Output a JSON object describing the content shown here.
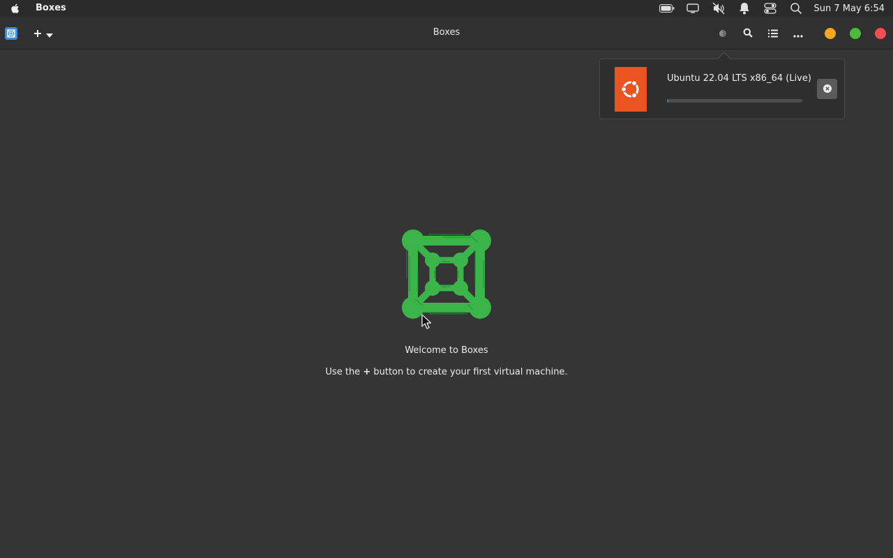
{
  "system_bar": {
    "app_name": "Boxes",
    "clock": "Sun 7 May 6:54",
    "icons": [
      "apple-icon",
      "battery-icon",
      "display-icon",
      "volume-muted-icon",
      "notification-bell-icon",
      "control-center-icon",
      "spotlight-search-icon"
    ]
  },
  "header": {
    "title": "Boxes",
    "icons": [
      "boxes-app-icon",
      "plus-icon",
      "chevron-down-icon",
      "downloads-indicator-icon",
      "search-icon",
      "list-view-icon",
      "more-options-icon"
    ],
    "window_controls": {
      "minimize_color": "#f5a623",
      "maximize_color": "#4cbb3c",
      "close_color": "#f0504f"
    }
  },
  "download": {
    "title": "Ubuntu 22.04 LTS x86_64 (Live)",
    "progress": 0.01,
    "logo_color": "#e95420",
    "accent_color": "#3584e4"
  },
  "empty_state": {
    "title": "Welcome to Boxes",
    "hint_prefix": "Use the",
    "hint_symbol": "+",
    "hint_suffix": "button to create your first virtual machine.",
    "logo_color": "#3bb54a"
  }
}
